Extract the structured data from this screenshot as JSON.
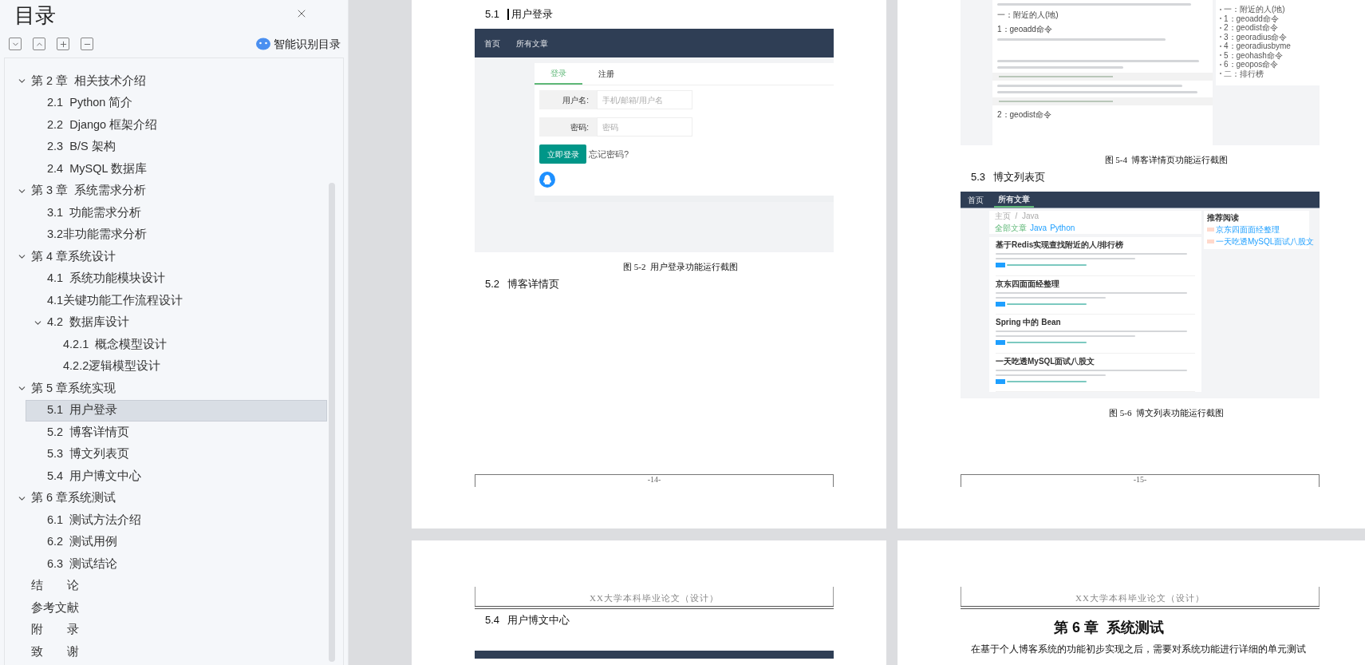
{
  "toc": {
    "title": "目录",
    "smart_button": "智能识别目录",
    "items": [
      {
        "label": "第 2 章  相关技术介绍",
        "expanded": true,
        "selected": false,
        "children": [
          {
            "label": "2.1  Python 简介",
            "selected": false
          },
          {
            "label": "2.2  Django 框架介绍",
            "selected": false
          },
          {
            "label": "2.3  B/S 架构",
            "selected": false
          },
          {
            "label": "2.4  MySQL 数据库",
            "selected": false
          }
        ]
      },
      {
        "label": "第 3 章  系统需求分析",
        "expanded": true,
        "selected": false,
        "children": [
          {
            "label": "3.1  功能需求分析",
            "selected": false
          },
          {
            "label": "3.2非功能需求分析",
            "selected": false
          }
        ]
      },
      {
        "label": "第 4 章系统设计",
        "expanded": true,
        "selected": false,
        "children": [
          {
            "label": "4.1  系统功能模块设计",
            "selected": false
          },
          {
            "label": "4.1关键功能工作流程设计",
            "selected": false
          },
          {
            "label": "4.2  数据库设计",
            "expanded": true,
            "selected": false,
            "children": [
              {
                "label": "4.2.1  概念模型设计",
                "selected": false
              },
              {
                "label": "4.2.2逻辑模型设计",
                "selected": false
              }
            ]
          }
        ]
      },
      {
        "label": "第 5 章系统实现",
        "expanded": true,
        "selected": false,
        "children": [
          {
            "label": "5.1  用户登录",
            "selected": true
          },
          {
            "label": "5.2  博客详情页",
            "selected": false
          },
          {
            "label": "5.3  博文列表页",
            "selected": false
          },
          {
            "label": "5.4  用户博文中心",
            "selected": false
          }
        ]
      },
      {
        "label": "第 6 章系统测试",
        "expanded": true,
        "selected": false,
        "children": [
          {
            "label": "6.1  测试方法介绍",
            "selected": false
          },
          {
            "label": "6.2  测试用例",
            "selected": false
          },
          {
            "label": "6.3  测试结论",
            "selected": false
          }
        ]
      },
      {
        "label": "结　　论",
        "selected": false
      },
      {
        "label": "参考文献",
        "selected": false
      },
      {
        "label": "附　　录",
        "selected": false
      },
      {
        "label": "致　　谢",
        "selected": false
      }
    ]
  },
  "pages_top": [
    {
      "blocks": [
        {
          "kind": "section_heading",
          "number": "5.1",
          "title": "用户登录",
          "marked": true
        },
        {
          "kind": "figure",
          "figure": {
            "kind": "login",
            "nav": [
              {
                "label": "首页",
                "selected": false
              },
              {
                "label": "所有文章",
                "selected": false
              }
            ],
            "tabs": [
              {
                "label": "登录",
                "selected": true
              },
              {
                "label": "注册",
                "selected": false
              }
            ],
            "fields": [
              {
                "label": "用户名:",
                "placeholder": "手机/邮箱/用户名"
              },
              {
                "label": "密码:",
                "placeholder": "密码"
              }
            ],
            "submit": "立即登录",
            "forgot": "忘记密码?"
          }
        },
        {
          "kind": "caption",
          "text": "图 5-2  用户登录功能运行截图"
        },
        {
          "kind": "section_heading",
          "number": "5.2",
          "title": "博客详情页",
          "marked": false
        },
        {
          "kind": "footer",
          "text": "-14-"
        }
      ]
    },
    {
      "blocks": [
        {
          "kind": "figure",
          "figure": {
            "kind": "detail",
            "content": [
              {
                "kind": "text_line"
              },
              {
                "kind": "heading",
                "text": "一：附近的人(地)"
              },
              {
                "kind": "heading",
                "text": "1：geoadd命令"
              },
              {
                "kind": "text_line"
              },
              {
                "kind": "gap"
              },
              {
                "kind": "text_line"
              },
              {
                "kind": "text_line"
              },
              {
                "kind": "code"
              },
              {
                "kind": "text_line"
              },
              {
                "kind": "text_line"
              },
              {
                "kind": "code"
              },
              {
                "kind": "heading",
                "text": "2：geodist命令"
              }
            ],
            "outline": [
              "一：附近的人(地)",
              "1：geoadd命令",
              "2：geodist命令",
              "3：georadius命令",
              "4：georadiusbyme",
              "5：geohash命令",
              "6：geopos命令",
              "二：排行榜"
            ]
          }
        },
        {
          "kind": "caption",
          "text": "图 5-4  博客详情页功能运行截图"
        },
        {
          "kind": "section_heading",
          "number": "5.3",
          "title": "博文列表页",
          "marked": false
        },
        {
          "kind": "figure",
          "figure": {
            "kind": "list",
            "nav": [
              {
                "label": "首页",
                "selected": false
              },
              {
                "label": "所有文章",
                "selected": true
              }
            ],
            "breadcrumb": "主页  /  Java",
            "filters": [
              {
                "label": "全部文章",
                "selected": true
              },
              {
                "label": "Java",
                "selected": false
              },
              {
                "label": "Python",
                "selected": false
              }
            ],
            "articles": [
              "基于Redis实现查找附近的人/排行榜",
              "京东四面面经整理",
              "Spring 中的 Bean",
              "一天吃透MySQL面试八股文"
            ],
            "side_title": "推荐阅读",
            "recommended": [
              "京东四面面经整理",
              "一天吃透MySQL面试八股文"
            ]
          }
        },
        {
          "kind": "caption",
          "text": "图 5-6  博文列表功能运行截图"
        },
        {
          "kind": "footer",
          "text": "-15-"
        }
      ]
    }
  ],
  "pages_bottom": [
    {
      "blocks": [
        {
          "kind": "header",
          "text": "XX大学本科毕业论文（设计）"
        },
        {
          "kind": "section_heading",
          "number": "5.4",
          "title": "用户博文中心",
          "marked": false
        },
        {
          "kind": "figure",
          "figure": {
            "kind": "navbar"
          }
        }
      ]
    },
    {
      "blocks": [
        {
          "kind": "header",
          "text": "XX大学本科毕业论文（设计）"
        },
        {
          "kind": "chapter_heading",
          "text": "第 6 章  系统测试"
        },
        {
          "kind": "paragraph",
          "text": "在基于个人博客系统的功能初步实现之后，需要对系统功能进行详细的单元测试"
        }
      ]
    }
  ]
}
